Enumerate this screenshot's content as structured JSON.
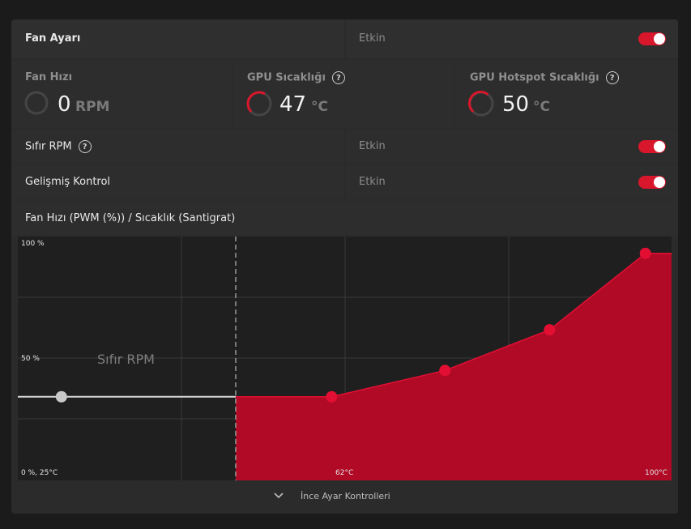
{
  "header": {
    "title": "Fan Ayarı",
    "status_label": "Etkin"
  },
  "metrics": [
    {
      "title": "Fan Hızı",
      "value": "0",
      "unit": "RPM"
    },
    {
      "title": "GPU Sıcaklığı",
      "value": "47",
      "unit": "°C"
    },
    {
      "title": "GPU Hotspot Sıcaklığı",
      "value": "50",
      "unit": "°C"
    }
  ],
  "zero_rpm": {
    "label": "Sıfır RPM",
    "status_label": "Etkin"
  },
  "advanced": {
    "label": "Gelişmiş Kontrol",
    "status_label": "Etkin"
  },
  "help_glyph": "?",
  "chart_header": "Fan Hızı (PWM (%)) / Sıcaklık (Santigrat)",
  "chart_labels": {
    "y_max": "100 %",
    "y_mid": "50 %",
    "origin": "0 %, 25°C",
    "x_mid": "62°C",
    "x_max": "100°C",
    "zero_rpm_region": "Sıfır RPM"
  },
  "chart_data": {
    "type": "area",
    "x_unit": "°C",
    "y_unit": "%",
    "xlim": [
      25,
      100
    ],
    "ylim": [
      0,
      100
    ],
    "zero_rpm_threshold": 50,
    "zero_rpm_point": {
      "x": 30,
      "y": 35
    },
    "points": [
      {
        "x": 61,
        "y": 35
      },
      {
        "x": 74,
        "y": 46
      },
      {
        "x": 86,
        "y": 63
      },
      {
        "x": 97,
        "y": 95
      }
    ]
  },
  "footer": {
    "label": "İnce Ayar Kontrolleri"
  },
  "colors": {
    "accent": "#d9172c",
    "fill": "#b00a26",
    "marker": "#e30f33"
  },
  "icons": {
    "gauge": "gauge-ring-icon",
    "toggle": "toggle-switch-icon",
    "help": "help-circle-icon",
    "chevron": "chevron-down-icon"
  }
}
